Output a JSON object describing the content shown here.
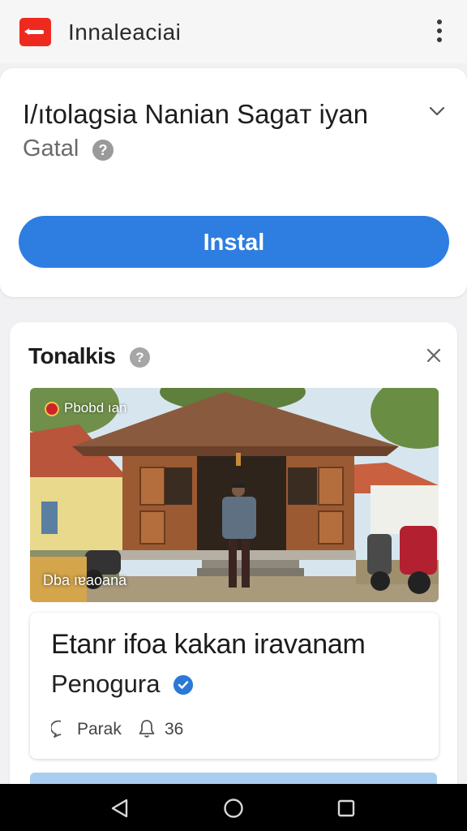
{
  "top_bar": {
    "title": "Innaleaciai",
    "logo_icon": "app-logo-icon",
    "menu_icon": "more-vert-icon"
  },
  "install_card": {
    "app_name": "I/ıtolagsia Nanian Sagaт iyan",
    "publisher": "Gatal",
    "help_glyph": "?",
    "install_label": "Instal",
    "expand_icon": "chevron-down-icon"
  },
  "ad_card": {
    "header_label": "Tonalkis",
    "help_glyph": "?",
    "close_icon": "close-icon",
    "image": {
      "badge_text": "Pbobd ıan",
      "caption": "Dba ıɐaoana"
    },
    "headline": "Etanr ifoa kakan iravanam",
    "author": "Penogura",
    "action_label": "Parak",
    "count": "36"
  },
  "colors": {
    "accent": "#2d7ee0",
    "logo_red": "#ee2a1e",
    "verified_blue": "#2b79d6"
  },
  "nav": {
    "back_icon": "back-icon",
    "home_icon": "home-icon",
    "recents_icon": "recents-icon"
  }
}
